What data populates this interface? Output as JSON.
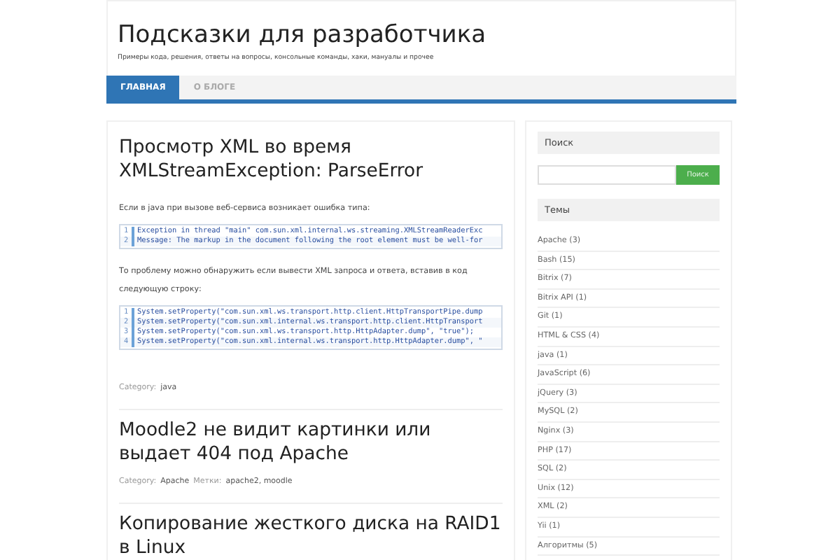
{
  "site": {
    "title": "Подсказки для разработчика",
    "tagline": "Примеры кода, решения, ответы на вопросы, консольные команды, хаки, мануалы и прочее"
  },
  "nav": [
    {
      "label": "ГЛАВНАЯ",
      "selected": true
    },
    {
      "label": "О БЛОГЕ",
      "selected": false
    }
  ],
  "posts": [
    {
      "title": "Просмотр XML во время XMLStreamException: ParseError",
      "blocks": [
        {
          "kind": "text",
          "text": "Если в java при вызове веб-сервиса возникает ошибка типа:"
        },
        {
          "kind": "code",
          "lines": [
            {
              "number": "1",
              "text": "Exception in thread \"main\" com.sun.xml.internal.ws.streaming.XMLStreamReaderExc"
            },
            {
              "number": "2",
              "text": "Message: The markup in the document following the root element must be well-for"
            }
          ]
        },
        {
          "kind": "text",
          "text": "То проблему можно обнаружить если вывести XML запроса и ответа, вставив в код следующую строку:"
        },
        {
          "kind": "code",
          "lines": [
            {
              "number": "1",
              "text": "System.setProperty(\"com.sun.xml.ws.transport.http.client.HttpTransportPipe.dump"
            },
            {
              "number": "2",
              "text": "System.setProperty(\"com.sun.xml.internal.ws.transport.http.client.HttpTransport"
            },
            {
              "number": "3",
              "text": "System.setProperty(\"com.sun.xml.ws.transport.http.HttpAdapter.dump\", \"true\");"
            },
            {
              "number": "4",
              "text": "System.setProperty(\"com.sun.xml.internal.ws.transport.http.HttpAdapter.dump\", \""
            }
          ]
        }
      ],
      "meta": [
        {
          "label": "Category:",
          "value": "java"
        }
      ]
    },
    {
      "title": "Moodle2 не видит картинки или выдает 404 под Apache",
      "meta": [
        {
          "label": "Category:",
          "value": "Apache"
        },
        {
          "label": "Метки:",
          "value": "apache2, moodle"
        }
      ]
    },
    {
      "title": "Копирование жесткого диска на RAID1 в Linux"
    }
  ],
  "sidebar": {
    "search": {
      "title": "Поиск",
      "button": "Поиск"
    },
    "topics": {
      "title": "Темы",
      "items": [
        "Apache (3)",
        "Bash (15)",
        "Bitrix (7)",
        "Bitrix API (1)",
        "Git (1)",
        "HTML & CSS (4)",
        "java (1)",
        "JavaScript (6)",
        "jQuery (3)",
        "MySQL (2)",
        "Nginx (3)",
        "PHP (17)",
        "SQL (2)",
        "Unix (12)",
        "XML (2)",
        "Yii (1)",
        "Алгоритмы (5)"
      ]
    }
  }
}
